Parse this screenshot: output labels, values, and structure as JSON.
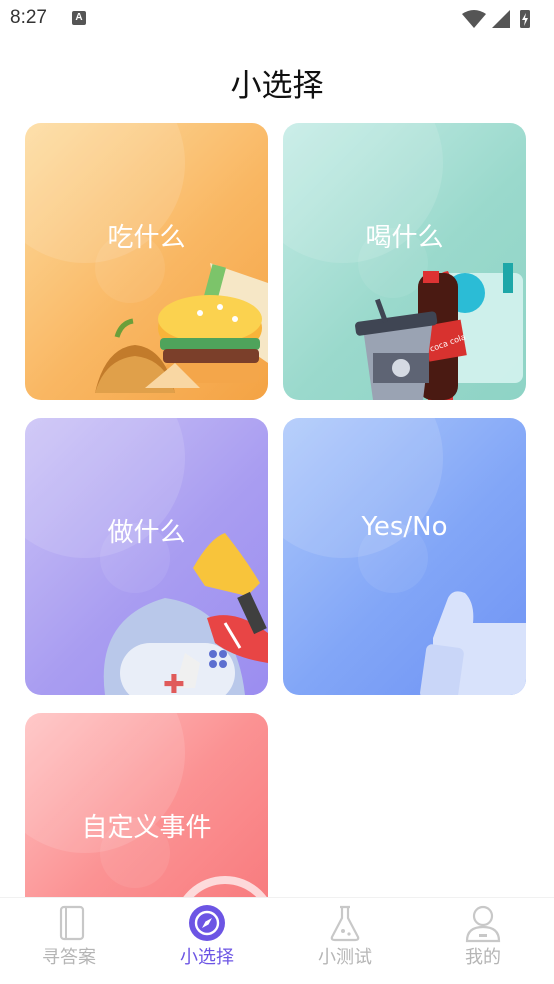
{
  "status_bar": {
    "time": "8:27",
    "notification_icon": "A",
    "icons": [
      "wifi-icon",
      "signal-icon",
      "battery-charging-icon"
    ]
  },
  "page": {
    "title": "小选择"
  },
  "cards": [
    {
      "id": "eat",
      "label": "吃什么",
      "icon": "food-illustration"
    },
    {
      "id": "drink",
      "label": "喝什么",
      "icon": "drinks-illustration"
    },
    {
      "id": "do",
      "label": "做什么",
      "icon": "activities-illustration"
    },
    {
      "id": "yesno",
      "label": "Yes/No",
      "icon": "thumbs-up-illustration"
    },
    {
      "id": "custom",
      "label": "自定义事件",
      "icon": "custom-event-illustration"
    }
  ],
  "bottom_nav": {
    "items": [
      {
        "label": "寻答案",
        "icon": "book-icon",
        "active": false
      },
      {
        "label": "小选择",
        "icon": "compass-icon",
        "active": true
      },
      {
        "label": "小测试",
        "icon": "flask-icon",
        "active": false
      },
      {
        "label": "我的",
        "icon": "user-icon",
        "active": false
      }
    ]
  },
  "colors": {
    "accent": "#6c55e4",
    "nav_inactive": "#b5b5b5",
    "eat_card": "#f9b763",
    "drink_card": "#9ad9cc",
    "do_card": "#a99df1",
    "yesno_card": "#82a6f7",
    "custom_card": "#fb9293"
  }
}
